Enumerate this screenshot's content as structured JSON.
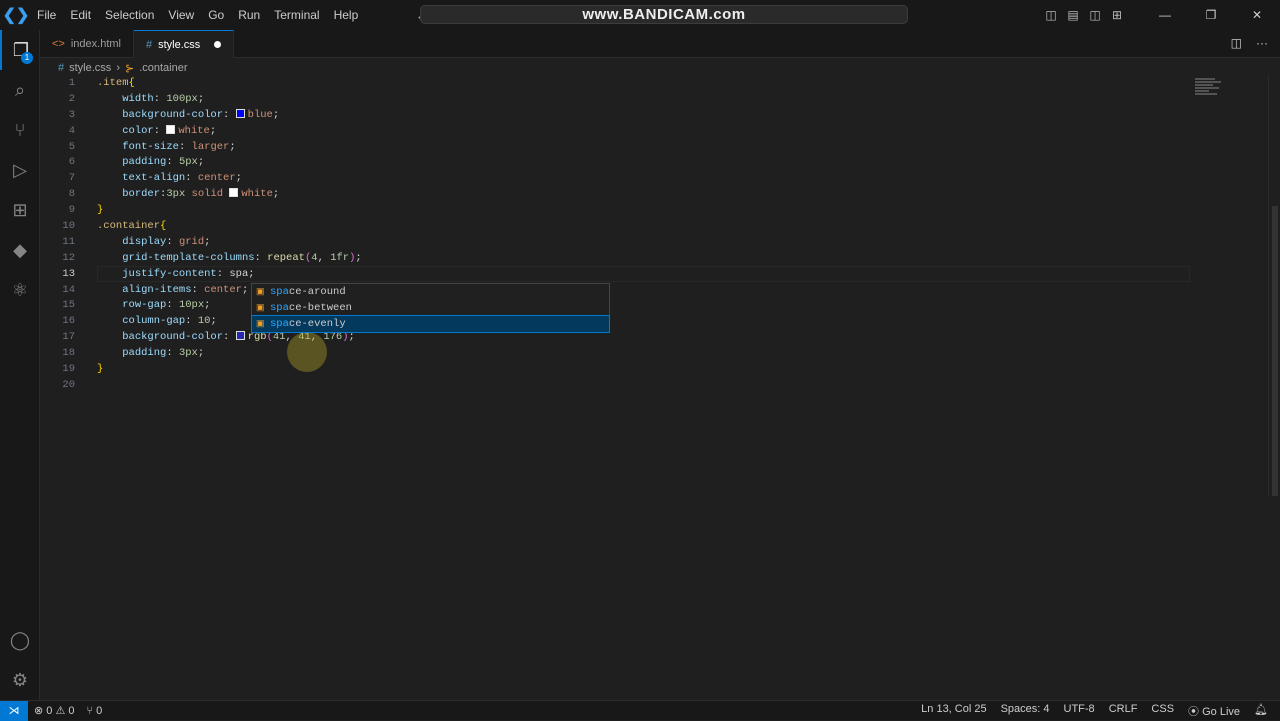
{
  "menu": [
    "File",
    "Edit",
    "Selection",
    "View",
    "Go",
    "Run",
    "Terminal",
    "Help"
  ],
  "title": "www.BANDICAM.com",
  "activity_badge": "1",
  "tabs": [
    {
      "label": "index.html",
      "icon": "<>"
    },
    {
      "label": "style.css",
      "icon": "#"
    }
  ],
  "breadcrumb": {
    "file": "style.css",
    "symbol": ".container"
  },
  "current_line": 13,
  "code": [
    [
      [
        "sel",
        ".item"
      ],
      [
        "b1",
        "{"
      ]
    ],
    [
      [
        "p",
        "    "
      ],
      [
        "pr",
        "width"
      ],
      [
        "p",
        ": "
      ],
      [
        "n",
        "100px"
      ],
      [
        "p",
        ";"
      ]
    ],
    [
      [
        "p",
        "    "
      ],
      [
        "pr",
        "background-color"
      ],
      [
        "p",
        ": "
      ],
      [
        "sw",
        "#0000ff"
      ],
      [
        "v",
        "blue"
      ],
      [
        "p",
        ";"
      ]
    ],
    [
      [
        "p",
        "    "
      ],
      [
        "pr",
        "color"
      ],
      [
        "p",
        ": "
      ],
      [
        "sw",
        "#ffffff"
      ],
      [
        "v",
        "white"
      ],
      [
        "p",
        ";"
      ]
    ],
    [
      [
        "p",
        "    "
      ],
      [
        "pr",
        "font-size"
      ],
      [
        "p",
        ": "
      ],
      [
        "v",
        "larger"
      ],
      [
        "p",
        ";"
      ]
    ],
    [
      [
        "p",
        "    "
      ],
      [
        "pr",
        "padding"
      ],
      [
        "p",
        ": "
      ],
      [
        "n",
        "5px"
      ],
      [
        "p",
        ";"
      ]
    ],
    [
      [
        "p",
        "    "
      ],
      [
        "pr",
        "text-align"
      ],
      [
        "p",
        ": "
      ],
      [
        "v",
        "center"
      ],
      [
        "p",
        ";"
      ]
    ],
    [
      [
        "p",
        "    "
      ],
      [
        "pr",
        "border"
      ],
      [
        "p",
        ":"
      ],
      [
        "n",
        "3px"
      ],
      [
        "v",
        " solid "
      ],
      [
        "sw",
        "#ffffff"
      ],
      [
        "v",
        "white"
      ],
      [
        "p",
        ";"
      ]
    ],
    [
      [
        "b1",
        "}"
      ]
    ],
    [
      [
        "sel",
        ".container"
      ],
      [
        "b1",
        "{"
      ]
    ],
    [
      [
        "p",
        "    "
      ],
      [
        "pr",
        "display"
      ],
      [
        "p",
        ": "
      ],
      [
        "v",
        "grid"
      ],
      [
        "p",
        ";"
      ]
    ],
    [
      [
        "p",
        "    "
      ],
      [
        "pr",
        "grid-template-columns"
      ],
      [
        "p",
        ": "
      ],
      [
        "f",
        "repeat"
      ],
      [
        "b2",
        "("
      ],
      [
        "n",
        "4"
      ],
      [
        "p",
        ", "
      ],
      [
        "n",
        "1fr"
      ],
      [
        "b2",
        ")"
      ],
      [
        "p",
        ";"
      ]
    ],
    [
      [
        "p",
        "    "
      ],
      [
        "pr",
        "justify-content"
      ],
      [
        "p",
        ": "
      ],
      [
        "p",
        "spa;"
      ]
    ],
    [
      [
        "p",
        "    "
      ],
      [
        "pr",
        "align-items"
      ],
      [
        "p",
        ": "
      ],
      [
        "v",
        "center"
      ],
      [
        "p",
        ";"
      ]
    ],
    [
      [
        "p",
        "    "
      ],
      [
        "pr",
        "row-gap"
      ],
      [
        "p",
        ": "
      ],
      [
        "n",
        "10px"
      ],
      [
        "p",
        ";"
      ]
    ],
    [
      [
        "p",
        "    "
      ],
      [
        "pr",
        "column-gap"
      ],
      [
        "p",
        ": "
      ],
      [
        "n",
        "10"
      ],
      [
        "p",
        ";"
      ]
    ],
    [
      [
        "p",
        "    "
      ],
      [
        "pr",
        "background-color"
      ],
      [
        "p",
        ": "
      ],
      [
        "sw",
        "#2929b0"
      ],
      [
        "f",
        "rgb"
      ],
      [
        "b2",
        "("
      ],
      [
        "n",
        "41"
      ],
      [
        "p",
        ", "
      ],
      [
        "n",
        "41"
      ],
      [
        "p",
        ", "
      ],
      [
        "n",
        "176"
      ],
      [
        "b2",
        ")"
      ],
      [
        "p",
        ";"
      ]
    ],
    [
      [
        "p",
        "    "
      ],
      [
        "pr",
        "padding"
      ],
      [
        "p",
        ": "
      ],
      [
        "n",
        "3px"
      ],
      [
        "p",
        ";"
      ]
    ],
    [
      [
        "b1",
        "}"
      ]
    ],
    []
  ],
  "suggestions": [
    {
      "match": "spa",
      "rest": "ce-around"
    },
    {
      "match": "spa",
      "rest": "ce-between"
    },
    {
      "match": "spa",
      "rest": "ce-evenly"
    }
  ],
  "selected_suggestion": 2,
  "status": {
    "errors": "0",
    "warnings": "0",
    "ports": "0",
    "position": "Ln 13, Col 25",
    "spaces": "Spaces: 4",
    "encoding": "UTF-8",
    "eol": "CRLF",
    "language": "CSS",
    "golive": "Go Live"
  }
}
